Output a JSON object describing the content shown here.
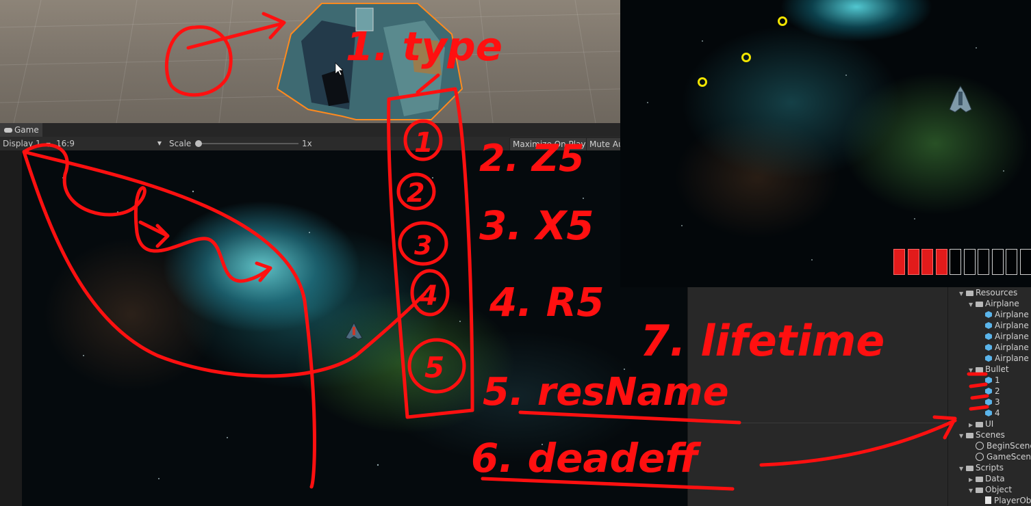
{
  "game_tab": {
    "label": "Game"
  },
  "game_toolbar": {
    "display": "Display 1",
    "aspect": "16:9",
    "scale_label": "Scale",
    "scale_value": "1x",
    "maximize_label": "Maximize On Play",
    "mute_label": "Mute Au"
  },
  "project_tree": [
    {
      "label": "Resources",
      "indent": 0,
      "kind": "folder",
      "expanded": true
    },
    {
      "label": "Airplane",
      "indent": 1,
      "kind": "folder",
      "expanded": true
    },
    {
      "label": "Airplane",
      "indent": 2,
      "kind": "prefab"
    },
    {
      "label": "Airplane",
      "indent": 2,
      "kind": "prefab"
    },
    {
      "label": "Airplane",
      "indent": 2,
      "kind": "prefab"
    },
    {
      "label": "Airplane",
      "indent": 2,
      "kind": "prefab"
    },
    {
      "label": "Airplane",
      "indent": 2,
      "kind": "prefab"
    },
    {
      "label": "Bullet",
      "indent": 1,
      "kind": "folder",
      "expanded": true
    },
    {
      "label": "1",
      "indent": 2,
      "kind": "prefab"
    },
    {
      "label": "2",
      "indent": 2,
      "kind": "prefab"
    },
    {
      "label": "3",
      "indent": 2,
      "kind": "prefab"
    },
    {
      "label": "4",
      "indent": 2,
      "kind": "prefab"
    },
    {
      "label": "UI",
      "indent": 1,
      "kind": "folder",
      "expanded": false
    },
    {
      "label": "Scenes",
      "indent": 0,
      "kind": "folder",
      "expanded": true
    },
    {
      "label": "BeginScene",
      "indent": 1,
      "kind": "scene"
    },
    {
      "label": "GameScene",
      "indent": 1,
      "kind": "scene"
    },
    {
      "label": "Scripts",
      "indent": 0,
      "kind": "folder",
      "expanded": true
    },
    {
      "label": "Data",
      "indent": 1,
      "kind": "folder",
      "expanded": false
    },
    {
      "label": "Object",
      "indent": 1,
      "kind": "folder",
      "expanded": true
    },
    {
      "label": "PlayerObject",
      "indent": 2,
      "kind": "script"
    }
  ],
  "preview": {
    "health_total": 10,
    "health_filled": 4
  },
  "annotations": {
    "item1": "1. type",
    "item2": "2. Z5",
    "item3": "3. X5",
    "item4": "4. R5",
    "item5": "5. resName",
    "item6": "6. deadeff",
    "item7": "7. lifetime",
    "circled": [
      "1",
      "2",
      "3",
      "4",
      "5"
    ]
  },
  "colors": {
    "annotation": "#ff1010",
    "bullet_ring": "#f1e400",
    "health_fill": "#e21b1b",
    "editor_bg": "#282828"
  }
}
